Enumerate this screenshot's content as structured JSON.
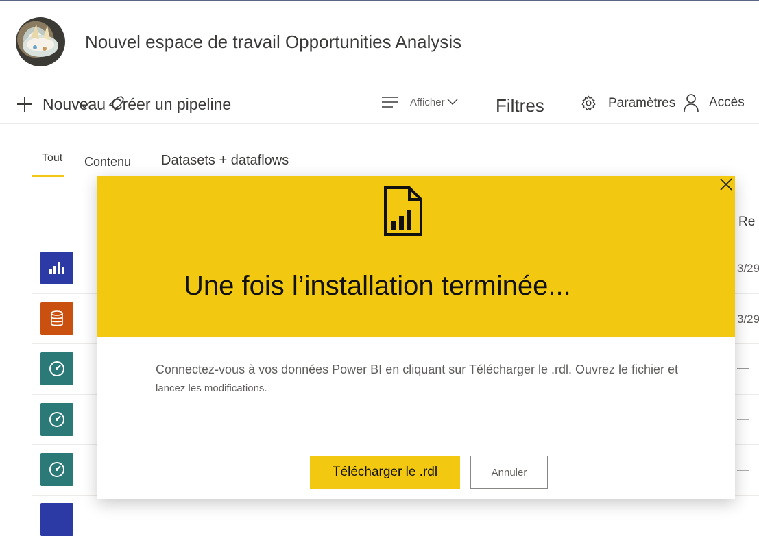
{
  "header": {
    "workspace_title": "Nouvel espace de travail Opportunities Analysis"
  },
  "toolbar": {
    "new_label": "Nouveau",
    "pipeline_label": "Créer un pipeline",
    "view_label": "Afficher",
    "filters_label": "Filtres",
    "settings_label": "Paramètres",
    "access_label": "Accès"
  },
  "tabs": [
    {
      "label": "Tout"
    },
    {
      "label": "Contenu"
    },
    {
      "label": "Datasets + dataflows"
    }
  ],
  "list": {
    "column_partial": "Re",
    "rows": [
      {
        "icon": "report-chart-icon",
        "date": "3/29"
      },
      {
        "icon": "dataset-database-icon",
        "date": "3/29"
      },
      {
        "icon": "dashboard-gauge-icon",
        "date": "—"
      },
      {
        "icon": "dashboard-gauge-icon",
        "date": "—"
      },
      {
        "icon": "dashboard-gauge-icon",
        "date": "—"
      }
    ]
  },
  "modal": {
    "title": "Une fois l’installation terminée...",
    "description_line1": "Connectez-vous à vos données Power BI en cliquant sur Télécharger le .rdl. Ouvrez le fichier et",
    "description_line2": "lancez les modifications.",
    "primary_button": "Télécharger le .rdl",
    "secondary_button": "Annuler"
  },
  "colors": {
    "accent_yellow": "#f2c811",
    "report_blue": "#2b3aa5",
    "dataset_orange": "#ca5010",
    "dashboard_teal": "#2b7a78"
  }
}
